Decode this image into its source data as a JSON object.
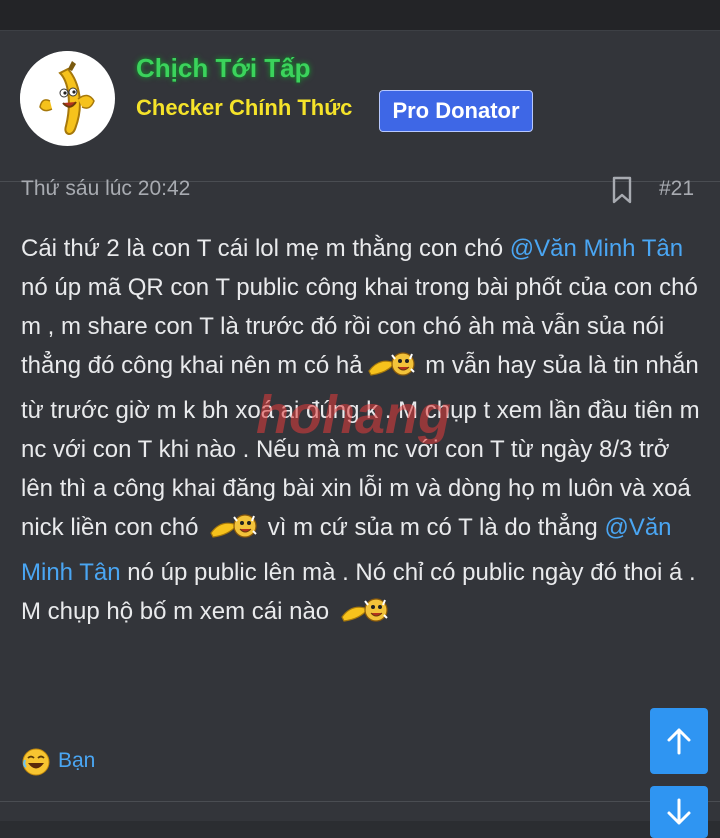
{
  "author": {
    "name": "Chịch Tới Tấp",
    "title": "Checker Chính Thức",
    "badge": "Pro Donator",
    "avatar_icon": "banana-mascot-avatar"
  },
  "post": {
    "date": "Thứ sáu lúc 20:42",
    "number": "#21",
    "body": {
      "s1": "Cái thứ 2 là con T cái lol mẹ m thằng con chó ",
      "mention1": "@Văn Minh Tân",
      "s2": " nó úp mã QR con T public công khai trong bài phốt của con chó m , m share con T là trước đó rồi con chó àh mà vẫn sủa nói thẳng đó công khai nên m có hả",
      "s3": " m vẫn hay sủa là tin nhắn từ trước giờ m k bh xoá ai đúng k . M chụp t xem lần đầu tiên m nc với con T khi nào . Nếu mà m nc với con T từ ngày 8/3 trở lên thì a công khai đăng bài xin lỗi m và dòng họ m luôn và xoá nick liền con chó ",
      "s4": " vì m cứ sủa m có T là do thẳng ",
      "mention2": "@Văn Minh Tân",
      "s5": " nó úp public lên mà . Nó chỉ có public ngày đó thoi á . M chụp hộ bố m xem cái nào ",
      "emoji_icon": "banana-laugh-emoji"
    },
    "reaction": {
      "label": "Bạn",
      "icon": "laugh-reaction-icon"
    }
  },
  "watermark": {
    "text": "hohang"
  },
  "colors": {
    "author_name": "#3bd35c",
    "author_title": "#f5e32a",
    "badge_bg": "#3e67e6",
    "mention": "#4aa6f3",
    "scroll_button": "#2f95f2"
  }
}
